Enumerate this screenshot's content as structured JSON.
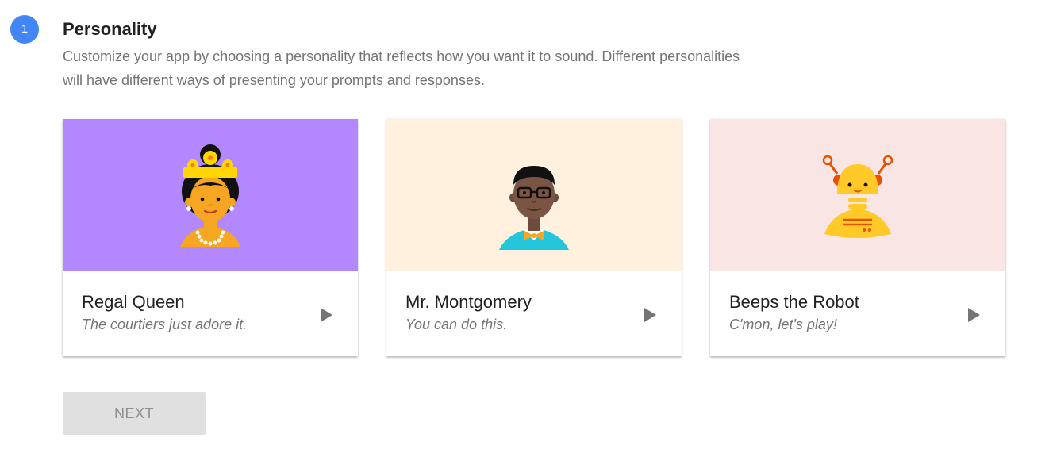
{
  "step": {
    "number": "1",
    "title": "Personality",
    "description": "Customize your app by choosing a personality that reflects how you want it to sound. Different personalities will have different ways of presenting your prompts and responses."
  },
  "cards": [
    {
      "name": "Regal Queen",
      "tagline": "The courtiers just adore it.",
      "background": "#b388ff",
      "icon": "queen-avatar-icon"
    },
    {
      "name": "Mr. Montgomery",
      "tagline": "You can do this.",
      "background": "#fff1de",
      "icon": "man-avatar-icon"
    },
    {
      "name": "Beeps the Robot",
      "tagline": "C'mon, let's play!",
      "background": "#f9e6e4",
      "icon": "robot-avatar-icon"
    }
  ],
  "next_button": {
    "label": "NEXT",
    "disabled": true
  },
  "colors": {
    "accent": "#4285f4",
    "play_icon": "#757575"
  }
}
